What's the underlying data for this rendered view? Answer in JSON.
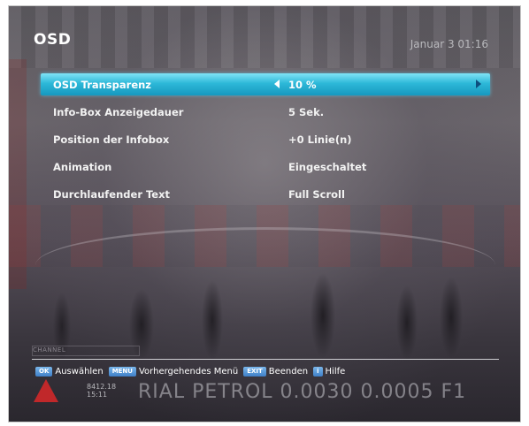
{
  "header": {
    "title": "OSD",
    "datetime": "Januar 3 01:16"
  },
  "menu": {
    "items": [
      {
        "label": "OSD Transparenz",
        "value": "10 %",
        "selected": true
      },
      {
        "label": "Info-Box Anzeigedauer",
        "value": "5 Sek."
      },
      {
        "label": "Position der Infobox",
        "value": "+0 Linie(n)"
      },
      {
        "label": "Animation",
        "value": "Eingeschaltet"
      },
      {
        "label": "Durchlaufender Text",
        "value": "Full Scroll"
      }
    ]
  },
  "helpbar": {
    "items": [
      {
        "key": "OK",
        "text": "Auswählen"
      },
      {
        "key": "MENU",
        "text": "Vorhergehendes Menü"
      },
      {
        "key": "EXIT",
        "text": "Beenden"
      },
      {
        "key": "i",
        "text": "Hilfe"
      }
    ]
  },
  "background": {
    "channel_tag": "CHANNEL",
    "ticker_small_1": "8412.18",
    "ticker_small_2": "15:11",
    "ticker_big": "RIAL PETROL 0.0030 0.0005 F1"
  },
  "colors": {
    "highlight": "#2db8d8",
    "key_blue": "#3f80c8",
    "text": "#ffffff"
  },
  "icons": {
    "left": "triangle-left-icon",
    "right": "triangle-right-icon"
  }
}
